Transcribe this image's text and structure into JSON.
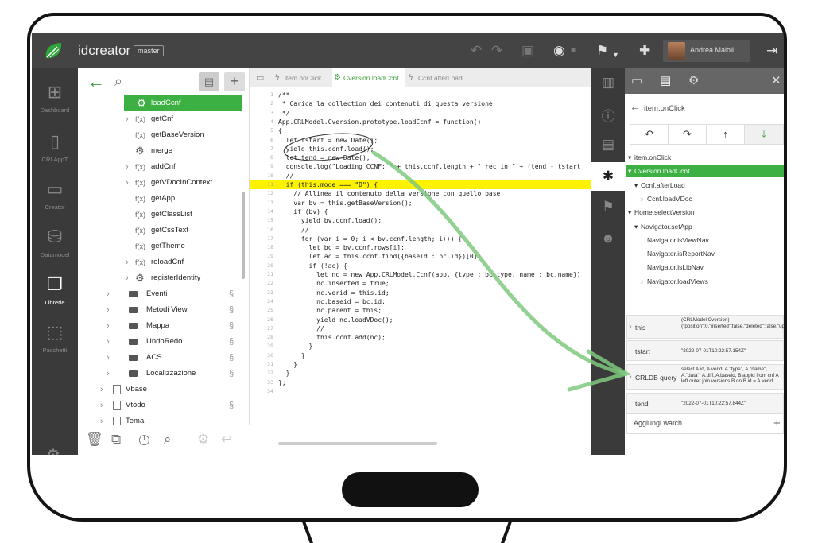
{
  "app": {
    "title": "idcreator",
    "branch": "master"
  },
  "topbar": {
    "icons": [
      "undo-icon",
      "redo-icon",
      "save-icon",
      "eye-off-icon",
      "signpost-icon",
      "add-user-icon",
      "logout-icon"
    ],
    "user_name": "Andrea Maioli"
  },
  "rail": {
    "items": [
      {
        "label": "Dashboard",
        "icon": "dashboard-icon"
      },
      {
        "label": "CRLAppT",
        "icon": "phone-icon"
      },
      {
        "label": "Creator",
        "icon": "monitor-icon"
      },
      {
        "label": "Datamodel",
        "icon": "database-icon"
      },
      {
        "label": "Librerie",
        "icon": "library-icon"
      },
      {
        "label": "Pacchetti",
        "icon": "packages-icon"
      }
    ]
  },
  "tree": {
    "items": [
      {
        "label": "loadCcnf",
        "kind": "gear"
      },
      {
        "label": "getCnf",
        "kind": "fx",
        "chevron": true
      },
      {
        "label": "getBaseVersion",
        "kind": "fx"
      },
      {
        "label": "merge",
        "kind": "gear"
      },
      {
        "label": "addCnf",
        "kind": "fx",
        "chevron": true
      },
      {
        "label": "getVDocInContext",
        "kind": "fx",
        "chevron": true
      },
      {
        "label": "getApp",
        "kind": "fx"
      },
      {
        "label": "getClassList",
        "kind": "fx"
      },
      {
        "label": "getCssText",
        "kind": "fx"
      },
      {
        "label": "getTheme",
        "kind": "fx"
      },
      {
        "label": "reloadCnf",
        "kind": "fx",
        "chevron": true
      },
      {
        "label": "registerIdentity",
        "kind": "gear",
        "chevron": true
      },
      {
        "label": "Eventi",
        "kind": "folder",
        "chevron": true
      },
      {
        "label": "Metodi View",
        "kind": "folder",
        "chevron": true
      },
      {
        "label": "Mappa",
        "kind": "folder",
        "chevron": true
      },
      {
        "label": "UndoRedo",
        "kind": "folder",
        "chevron": true
      },
      {
        "label": "ACS",
        "kind": "folder",
        "chevron": true
      },
      {
        "label": "Localizzazione",
        "kind": "folder",
        "chevron": true
      },
      {
        "label": "Vbase",
        "kind": "doc",
        "chevron": true
      },
      {
        "label": "Vtodo",
        "kind": "doc",
        "chevron": true
      },
      {
        "label": "Tema",
        "kind": "doc",
        "chevron": true
      }
    ]
  },
  "fx_symbol": "f(x)",
  "tabs": [
    {
      "label": "item.onClick"
    },
    {
      "label": "Cversion.loadCcnf"
    },
    {
      "label": "Ccnf.afterLoad"
    }
  ],
  "code": {
    "highlight_line": 11,
    "lines": [
      "/**",
      " * Carica la collection dei contenuti di questa versione",
      " */",
      "App.CRLModel.Cversion.prototype.loadCcnf = function()",
      "{",
      "  let tstart = new Date();",
      "  yield this.ccnf.load();",
      "  let tend = new Date();",
      "  console.log(\"Loading CCNF: \" + this.ccnf.length + \" rec in \" + (tend - tstart",
      "  //",
      "  if (this.mode === \"D\") {",
      "    // Allinea il contenuto della versione con quello base",
      "    var bv = this.getBaseVersion();",
      "    if (bv) {",
      "      yield bv.ccnf.load();",
      "      //",
      "      for (var i = 0; i < bv.ccnf.length; i++) {",
      "        let bc = bv.ccnf.rows[i];",
      "        let ac = this.ccnf.find({baseid : bc.id})[0];",
      "        if (!ac) {",
      "          let nc = new App.CRLModel.Ccnf(app, {type : bc.type, name : bc.name})",
      "          nc.inserted = true;",
      "          nc.verid = this.id;",
      "          nc.baseid = bc.id;",
      "          nc.parent = this;",
      "          yield nc.loadVDoc();",
      "          //",
      "          this.ccnf.add(nc);",
      "        }",
      "      }",
      "    }",
      "  }",
      "};",
      ""
    ]
  },
  "debugger": {
    "function": "item.onClick",
    "step_buttons": [
      "step-back-icon",
      "step-over-icon",
      "step-out-icon",
      "step-into-icon"
    ],
    "stack": [
      {
        "label": "item.onClick",
        "depth": 0,
        "chev": "▾"
      },
      {
        "label": "Cversion.loadCcnf",
        "depth": 0,
        "chev": "▾",
        "selected": true
      },
      {
        "label": "Ccnf.afterLoad",
        "depth": 1,
        "chev": "▾"
      },
      {
        "label": "Ccnf.loadVDoc",
        "depth": 2,
        "chev": "›"
      },
      {
        "label": "Home.selectVersion",
        "depth": 0,
        "chev": "▾"
      },
      {
        "label": "Navigator.setApp",
        "depth": 1,
        "chev": "▾"
      },
      {
        "label": "Navigator.isViewNav",
        "depth": 2,
        "chev": ""
      },
      {
        "label": "Navigator.isReportNav",
        "depth": 2,
        "chev": ""
      },
      {
        "label": "Navigator.isLibNav",
        "depth": 2,
        "chev": ""
      },
      {
        "label": "Navigator.loadViews",
        "depth": 2,
        "chev": "›"
      }
    ],
    "watches": [
      {
        "key": "this",
        "value": "(CRLModel.Cversion) {\"position\":0,\"inserted\":false,\"deleted\":false,\"updated\":false,\"hidden\":false,\"id\":\"HxJ2"
      },
      {
        "key": "tstart",
        "value": "\"2022-07-01T10:22:57.154Z\""
      },
      {
        "key": "CRLDB query",
        "value": "select A.id, A.verid, A.\"type\", A.\"name\", A.\"data\", A.diff, A.baseid, B.appid from cnf A left outer join versions B on B.id = A.verid"
      },
      {
        "key": "tend",
        "value": "\"2022-07-01T10:22:57.844Z\""
      }
    ],
    "add_watch": "Aggiungi watch"
  },
  "colors": {
    "accent": "#3cb043",
    "highlight": "#fff200",
    "annotation": "#7fc97f"
  }
}
